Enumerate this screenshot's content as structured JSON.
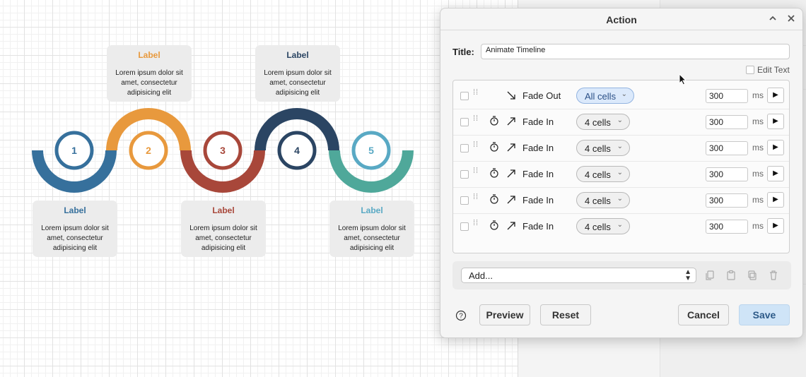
{
  "canvas": {
    "steps": [
      {
        "number": "1",
        "color": "#36709c",
        "card_title": "Label",
        "card_body": "Lorem ipsum dolor sit amet, consectetur adipisicing elit"
      },
      {
        "number": "2",
        "color": "#e8993d",
        "card_title": "Label",
        "card_body": "Lorem ipsum dolor sit amet, consectetur adipisicing elit"
      },
      {
        "number": "3",
        "color": "#a8473a",
        "card_title": "Label",
        "card_body": "Lorem ipsum dolor sit amet, consectetur adipisicing elit"
      },
      {
        "number": "4",
        "color": "#2b4563",
        "card_title": "Label",
        "card_body": "Lorem ipsum dolor sit amet, consectetur adipisicing elit"
      },
      {
        "number": "5",
        "color": "#4fa89a",
        "card_title": "Label",
        "card_body": "Lorem ipsum dolor sit amet, consectetur adipisicing elit"
      }
    ],
    "step5_ring_color": "#59a9c4"
  },
  "dialog": {
    "title": "Action",
    "title_label": "Title:",
    "title_value": "Animate Timeline",
    "edit_text_label": "Edit Text",
    "steps": [
      {
        "timer": false,
        "effect_icon": "arrow-down-right-icon",
        "effect": "Fade Out",
        "target": "All cells",
        "target_active": true,
        "duration": "300",
        "unit": "ms"
      },
      {
        "timer": true,
        "effect_icon": "arrow-up-right-icon",
        "effect": "Fade In",
        "target": "4 cells",
        "target_active": false,
        "duration": "300",
        "unit": "ms"
      },
      {
        "timer": true,
        "effect_icon": "arrow-up-right-icon",
        "effect": "Fade In",
        "target": "4 cells",
        "target_active": false,
        "duration": "300",
        "unit": "ms"
      },
      {
        "timer": true,
        "effect_icon": "arrow-up-right-icon",
        "effect": "Fade In",
        "target": "4 cells",
        "target_active": false,
        "duration": "300",
        "unit": "ms"
      },
      {
        "timer": true,
        "effect_icon": "arrow-up-right-icon",
        "effect": "Fade In",
        "target": "4 cells",
        "target_active": false,
        "duration": "300",
        "unit": "ms"
      },
      {
        "timer": true,
        "effect_icon": "arrow-up-right-icon",
        "effect": "Fade In",
        "target": "4 cells",
        "target_active": false,
        "duration": "300",
        "unit": "ms"
      }
    ],
    "add_select_value": "Add...",
    "buttons": {
      "preview": "Preview",
      "reset": "Reset",
      "cancel": "Cancel",
      "save": "Save"
    },
    "accent_color": "#cfe4f7"
  }
}
